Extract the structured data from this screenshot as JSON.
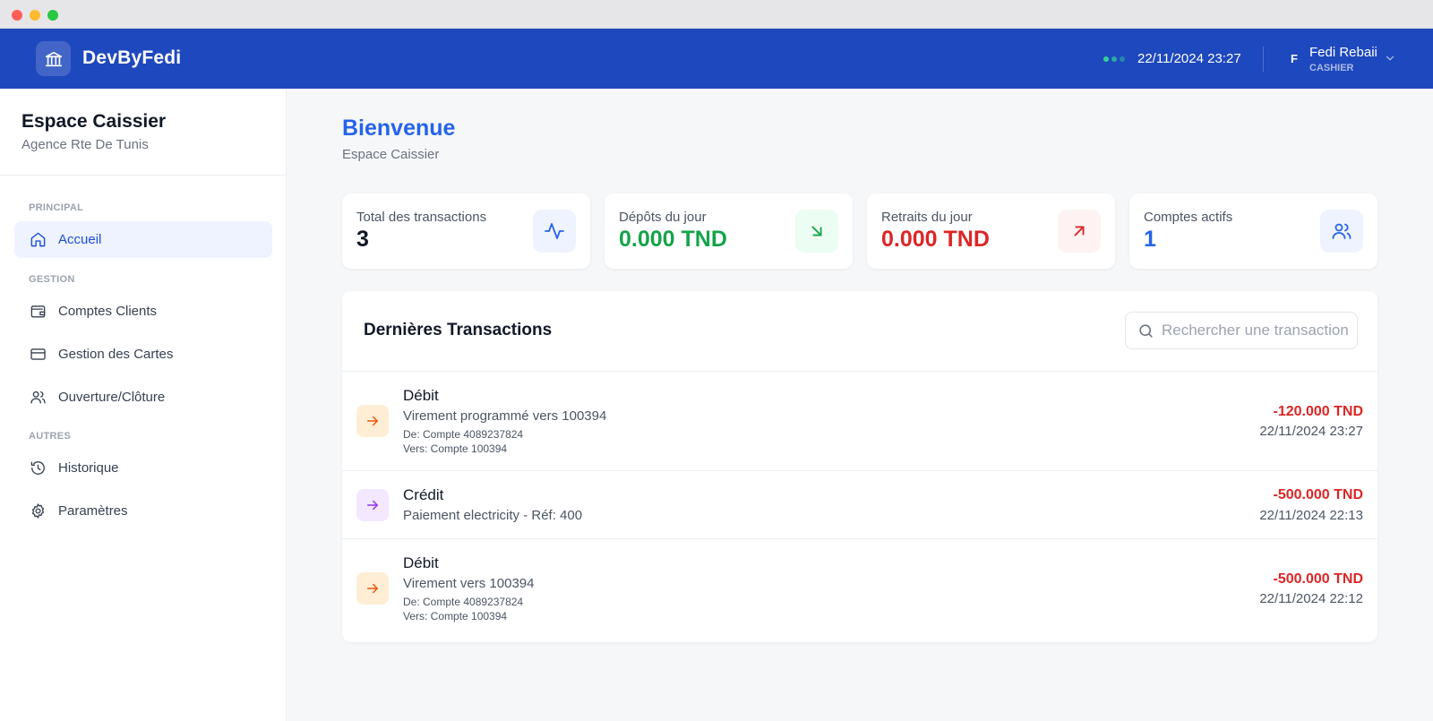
{
  "header": {
    "brand": "DevByFedi",
    "datetime": "22/11/2024 23:27",
    "user_initial": "F",
    "user_name": "Fedi Rebaii",
    "user_role": "CASHIER"
  },
  "sidebar": {
    "title": "Espace Caissier",
    "subtitle": "Agence Rte De Tunis",
    "sections": [
      {
        "label": "PRINCIPAL",
        "items": [
          {
            "label": "Accueil",
            "icon": "home-icon",
            "active": true
          }
        ]
      },
      {
        "label": "GESTION",
        "items": [
          {
            "label": "Comptes Clients",
            "icon": "wallet-icon"
          },
          {
            "label": "Gestion des Cartes",
            "icon": "credit-card-icon"
          },
          {
            "label": "Ouverture/Clôture",
            "icon": "users-icon"
          }
        ]
      },
      {
        "label": "AUTRES",
        "items": [
          {
            "label": "Historique",
            "icon": "history-icon"
          },
          {
            "label": "Paramètres",
            "icon": "settings-icon"
          }
        ]
      }
    ]
  },
  "main": {
    "greeting": "Bienvenue",
    "greeting_sub": "Espace Caissier",
    "stats": [
      {
        "label": "Total des transactions",
        "value": "3",
        "icon": "activity-icon",
        "color": "#111827",
        "icon_color": "#2563eb",
        "icon_bg": "#eef3ff"
      },
      {
        "label": "Dépôts du jour",
        "value": "0.000 TND",
        "icon": "arrow-down-right-icon",
        "color": "#16a34a",
        "icon_color": "#16a34a",
        "icon_bg": "#ecfdf3"
      },
      {
        "label": "Retraits du jour",
        "value": "0.000 TND",
        "icon": "arrow-up-right-icon",
        "color": "#dc2626",
        "icon_color": "#dc2626",
        "icon_bg": "#fef2f2"
      },
      {
        "label": "Comptes actifs",
        "value": "1",
        "icon": "users-icon",
        "color": "#2563eb",
        "icon_color": "#2563eb",
        "icon_bg": "#eef3ff"
      }
    ],
    "transactions_panel": {
      "title": "Dernières Transactions",
      "search_placeholder": "Rechercher une transaction..."
    },
    "transactions": [
      {
        "type": "Débit",
        "description": "Virement programmé vers 100394",
        "from": "De: Compte 4089237824",
        "to": "Vers: Compte 100394",
        "amount": "-120.000 TND",
        "date": "22/11/2024 23:27",
        "icon": "arrow-right-icon",
        "icon_color": "#ea580c",
        "icon_bg": "#ffedd5"
      },
      {
        "type": "Crédit",
        "description": "Paiement electricity - Réf: 400",
        "amount": "-500.000 TND",
        "date": "22/11/2024 22:13",
        "icon": "arrow-right-icon",
        "icon_color": "#9333ea",
        "icon_bg": "#f3e8ff"
      },
      {
        "type": "Débit",
        "description": "Virement vers 100394",
        "from": "De: Compte 4089237824",
        "to": "Vers: Compte 100394",
        "amount": "-500.000 TND",
        "date": "22/11/2024 22:12",
        "icon": "arrow-right-icon",
        "icon_color": "#ea580c",
        "icon_bg": "#ffedd5"
      }
    ]
  }
}
